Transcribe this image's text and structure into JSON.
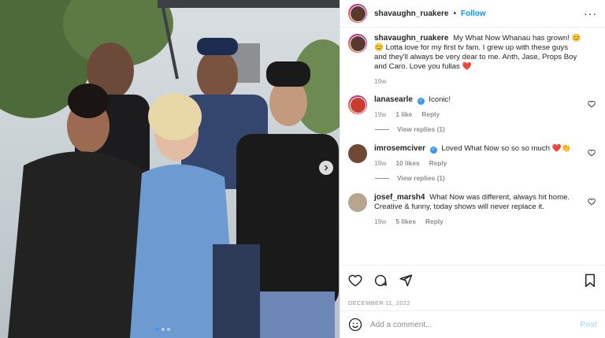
{
  "post": {
    "username": "shavaughn_ruakere",
    "follow_label": "Follow",
    "more_icon": "more-horizontal-icon",
    "date": "DECEMBER 11, 2022",
    "caption": {
      "username": "shavaughn_ruakere",
      "text": "My What Now Whanau has grown! 😊😊 Lotta love for my first tv fam. I grew up with these guys and they'll always be very dear to me. Anth, Jase, Props Boy and Caro. Love you fullas ❤️",
      "age": "19w"
    }
  },
  "comments": [
    {
      "username": "lanasearle",
      "verified": true,
      "text": "Iconic!",
      "age": "19w",
      "likes": "1 like",
      "reply": "Reply",
      "view_replies": "View replies (1)"
    },
    {
      "username": "imrosemciver",
      "verified": true,
      "text": "Loved What Now so so so much ❤️👏",
      "age": "19w",
      "likes": "10 likes",
      "reply": "Reply",
      "view_replies": "View replies (1)"
    },
    {
      "username": "josef_marsh4",
      "verified": false,
      "text": "What Now was different, always hit home. Creative & funny, today shows will never replace it.",
      "age": "19w",
      "likes": "5 likes",
      "reply": "Reply"
    }
  ],
  "composer": {
    "placeholder": "Add a comment...",
    "post_label": "Post"
  },
  "icons": {
    "like": "heart-icon",
    "comment": "comment-icon",
    "share": "share-icon",
    "save": "bookmark-icon",
    "emoji": "emoji-icon"
  },
  "colors": {
    "link_blue": "#0095f6",
    "muted": "#8e8e8e",
    "text": "#262626",
    "like_red": "#ed4956"
  }
}
